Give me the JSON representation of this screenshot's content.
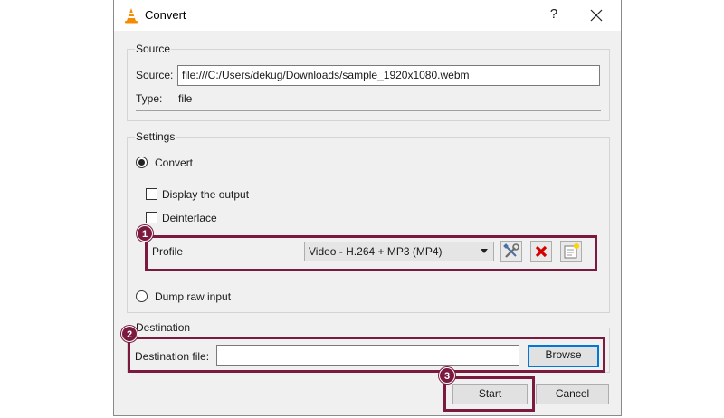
{
  "window": {
    "title": "Convert",
    "help_label": "?"
  },
  "source": {
    "group_title": "Source",
    "source_label": "Source:",
    "source_value": "file:///C:/Users/dekug/Downloads/sample_1920x1080.webm",
    "type_label": "Type:",
    "type_value": "file"
  },
  "settings": {
    "group_title": "Settings",
    "convert_label": "Convert",
    "convert_selected": true,
    "display_output_label": "Display the output",
    "display_output_checked": false,
    "deinterlace_label": "Deinterlace",
    "deinterlace_checked": false,
    "profile_label": "Profile",
    "profile_selected": "Video - H.264 + MP3 (MP4)",
    "profile_tools": [
      "edit-profile-icon",
      "delete-profile-icon",
      "new-profile-icon"
    ],
    "dump_raw_label": "Dump raw input",
    "dump_raw_selected": false
  },
  "destination": {
    "group_title": "Destination",
    "file_label": "Destination file:",
    "file_value": "",
    "browse_label": "Browse"
  },
  "actions": {
    "start_label": "Start",
    "cancel_label": "Cancel"
  },
  "annotations": [
    "1",
    "2",
    "3"
  ],
  "colors": {
    "annotation": "#7a1a3e",
    "focus": "#0078d7",
    "delete_icon": "#d40000"
  }
}
